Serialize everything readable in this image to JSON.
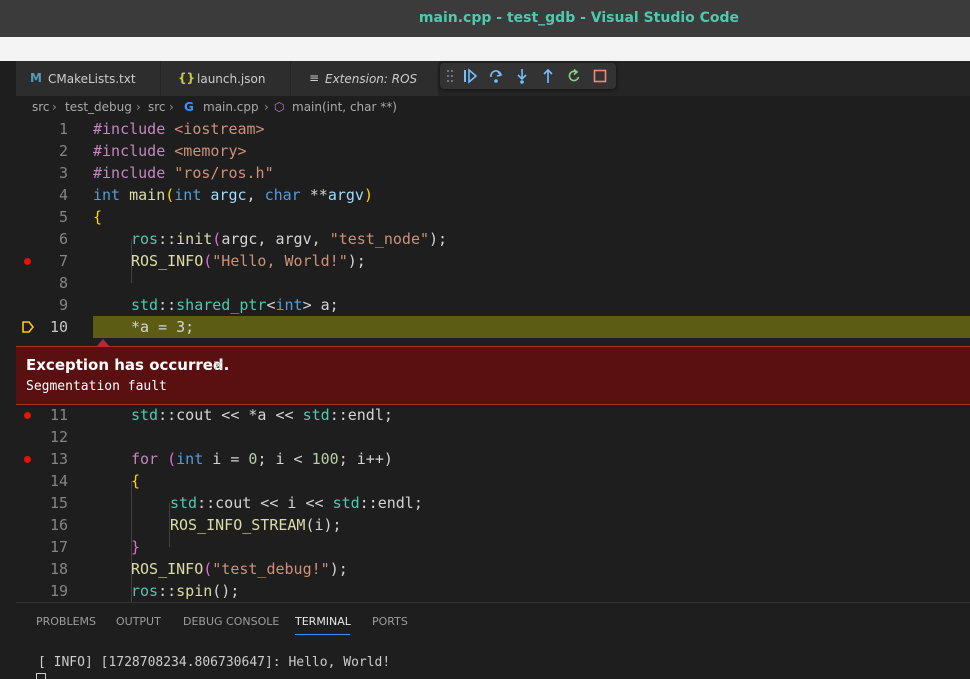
{
  "window": {
    "title": "main.cpp - test_gdb - Visual Studio Code"
  },
  "tabs": [
    {
      "icon": "M",
      "label": "CMakeLists.txt"
    },
    {
      "icon": "{}",
      "label": "launch.json"
    },
    {
      "icon": "≡",
      "label": "Extension: ROS"
    }
  ],
  "debug_toolbar": {
    "buttons": [
      "continue",
      "step-over",
      "step-into",
      "step-out",
      "restart",
      "stop"
    ]
  },
  "breadcrumb": {
    "items": [
      "src",
      "test_debug",
      "src",
      "main.cpp",
      "main(int, char **)"
    ]
  },
  "editor": {
    "lines": [
      {
        "n": "1"
      },
      {
        "n": "2"
      },
      {
        "n": "3"
      },
      {
        "n": "4"
      },
      {
        "n": "5"
      },
      {
        "n": "6"
      },
      {
        "n": "7"
      },
      {
        "n": "8"
      },
      {
        "n": "9"
      },
      {
        "n": "10"
      },
      {
        "n": "11"
      },
      {
        "n": "12"
      },
      {
        "n": "13"
      },
      {
        "n": "14"
      },
      {
        "n": "15"
      },
      {
        "n": "16"
      },
      {
        "n": "17"
      },
      {
        "n": "18"
      },
      {
        "n": "19"
      }
    ],
    "code": {
      "l1a": "#include ",
      "l1b": "<iostream>",
      "l2a": "#include ",
      "l2b": "<memory>",
      "l3a": "#include ",
      "l3b": "\"ros/ros.h\"",
      "l4": [
        "int",
        " ",
        "main",
        "(",
        "int",
        " ",
        "argc",
        ", ",
        "char",
        " **",
        "argv",
        ")"
      ],
      "l5": "{",
      "l6": [
        "ros",
        "::",
        "init",
        "(",
        "argc, argv, ",
        "\"test_node\"",
        ");"
      ],
      "l7": [
        "ROS_INFO",
        "(",
        "\"Hello, World!\"",
        ");"
      ],
      "l9": [
        "std",
        "::",
        "shared_ptr",
        "<",
        "int",
        "> a;"
      ],
      "l10": "*a = 3;",
      "l11": [
        "std",
        "::",
        "cout << *a << ",
        "std",
        "::",
        "endl;"
      ],
      "l13": [
        "for",
        " (",
        "int",
        " i = ",
        "0",
        "; i < ",
        "100",
        "; i++)"
      ],
      "l14": "{",
      "l15": [
        "std",
        "::",
        "cout << i << ",
        "std",
        "::",
        "endl;"
      ],
      "l16": [
        "ROS_INFO_STREAM",
        "(i);"
      ],
      "l17": "}",
      "l18": [
        "ROS_INFO",
        "(",
        "\"test_debug!\"",
        ");"
      ],
      "l19": [
        "ros",
        "::",
        "spin",
        "();"
      ]
    }
  },
  "exception": {
    "title": "Exception has occurred.",
    "close": "×",
    "message": "Segmentation fault"
  },
  "panel": {
    "tabs": [
      "PROBLEMS",
      "OUTPUT",
      "DEBUG CONSOLE",
      "TERMINAL",
      "PORTS"
    ],
    "active": "TERMINAL",
    "terminal_line": "[ INFO] [1728708234.806730647]: Hello, World!"
  },
  "colors": {
    "accent": "#3794ff",
    "breakpoint": "#e51400",
    "current_line": "#5c5c15",
    "exception_bg": "#5a1010"
  }
}
